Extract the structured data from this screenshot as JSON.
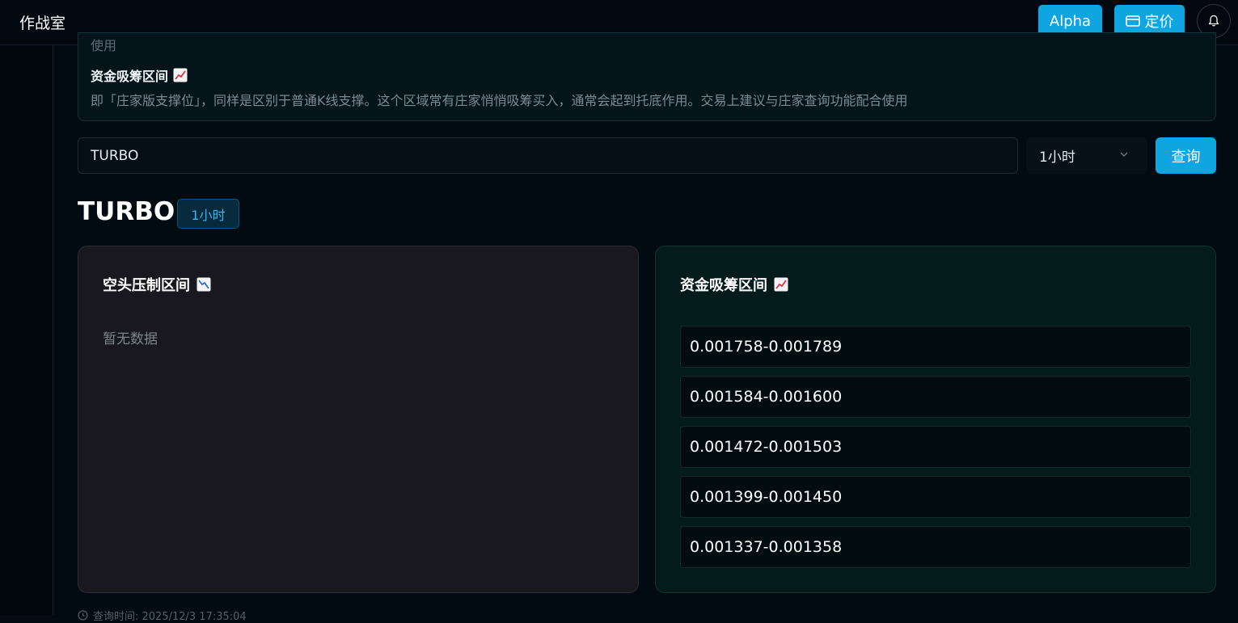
{
  "header": {
    "title": "作战室",
    "alpha_label": "Alpha",
    "pricing_label": "定价"
  },
  "info": {
    "prev_text": "使用",
    "heading": "资金吸筹区间",
    "description": "即「庄家版支撑位」，同样是区别于普通K线支撑。这个区域常有庄家悄悄吸筹买入，通常会起到托底作用。交易上建议与庄家查询功能配合使用"
  },
  "search": {
    "value": "TURBO",
    "interval_selected": "1小时",
    "query_label": "查询"
  },
  "result": {
    "symbol": "TURBO",
    "interval_badge": "1小时"
  },
  "bear_panel": {
    "title": "空头压制区间",
    "empty": "暂无数据"
  },
  "bull_panel": {
    "title": "资金吸筹区间",
    "ranges": [
      "0.001758-0.001789",
      "0.001584-0.001600",
      "0.001472-0.001503",
      "0.001399-0.001450",
      "0.001337-0.001358"
    ]
  },
  "footer": {
    "time_text": "查询时间: 2025/12/3 17:35:04"
  },
  "colors": {
    "accent": "#0ea5e0",
    "bull_bg": "#041b1c",
    "bear_bg": "#18181e"
  }
}
